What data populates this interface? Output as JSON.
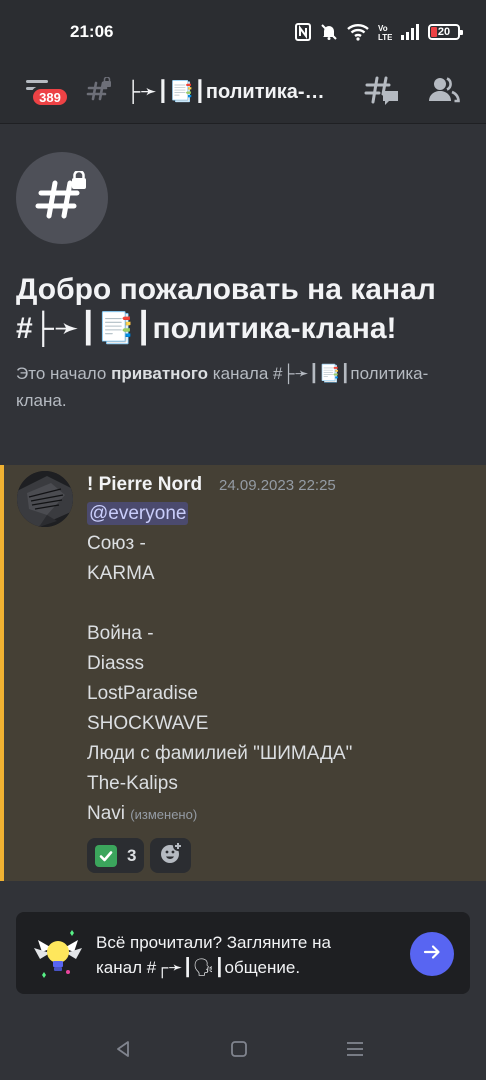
{
  "status_bar": {
    "time": "21:06",
    "battery_level": "20",
    "battery_color": "#ed4245",
    "icons": [
      "nfc-icon",
      "mute-icon",
      "wifi-icon",
      "volte-icon",
      "signal-icon",
      "battery-icon"
    ]
  },
  "header": {
    "unread_badge": "389",
    "channel_title": "├➛┃📑┃политика-…",
    "icons": [
      "menu-icon",
      "locked-hash-icon",
      "threads-icon",
      "members-icon"
    ]
  },
  "welcome": {
    "title": "Добро пожаловать на канал #├➛┃📑┃политика-клана!",
    "subtitle_prefix": "Это начало ",
    "subtitle_bold": "приватного",
    "subtitle_suffix": " канала #├➛┃📑┃политика-клана."
  },
  "message": {
    "author": "! Pierre Nord",
    "timestamp": "24.09.2023 22:25",
    "mention": "@everyone",
    "lines": [
      "Союз -",
      "KARMA",
      "",
      "Война -",
      "Diasss",
      "LostParadise",
      "SHOCKWAVE",
      "Люди с фамилией \"ШИМАДА\"",
      "The-Kalips",
      "Navi"
    ],
    "edited_label": "(изменено)",
    "highlight_color": "#f0b232",
    "reactions": [
      {
        "emoji": "check-mark-emoji",
        "count": "3"
      }
    ]
  },
  "nudge": {
    "line1": "Всё прочитали? Загляните на",
    "line2": "канал #┌➛┃🗣┃общение."
  },
  "nav_bar": {
    "icons": [
      "back-icon",
      "home-icon",
      "recents-icon"
    ]
  }
}
